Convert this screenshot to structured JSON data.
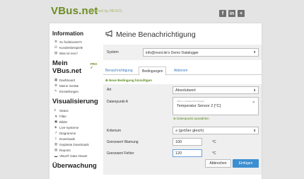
{
  "header": {
    "logo": "VBus.net",
    "logo_sub": "powered by RESOL",
    "social": [
      "f",
      "in",
      "+"
    ]
  },
  "sidebar": {
    "section_information": "Information",
    "information_items": [
      {
        "icon": "gear",
        "label": "So funktioniert's"
      },
      {
        "icon": "sliders",
        "label": "Kundenbeispiele"
      },
      {
        "icon": "doc",
        "label": "Was ist neu?"
      }
    ],
    "section_mein": "Mein VBus.net",
    "pro_badge": "PRO ✔",
    "mein_items": [
      {
        "icon": "dashboard",
        "label": "Dashboard"
      },
      {
        "icon": "gear",
        "label": "Meine Geräte"
      },
      {
        "icon": "wrench",
        "label": "Einstellungen"
      }
    ],
    "section_visual": "Visualisierung",
    "visual_items": [
      {
        "icon": "info",
        "label": "Status"
      },
      {
        "icon": "filter",
        "label": "Filter"
      },
      {
        "icon": "image",
        "label": "Bilder"
      },
      {
        "icon": "system",
        "label": "Live-Systeme"
      },
      {
        "icon": "chart",
        "label": "Diagramme"
      },
      {
        "icon": "download",
        "label": "Downloads"
      },
      {
        "icon": "calendar",
        "label": "Geplante Downloads"
      },
      {
        "icon": "reports",
        "label": "Reports"
      },
      {
        "icon": "viewer",
        "label": "VBus® Data Viewer"
      }
    ],
    "section_monitor": "Überwachung"
  },
  "main": {
    "title": "Meine Benachrichtigung",
    "system_label": "System",
    "system_value": "info@resol.de's Demo Datalogger",
    "tabs": [
      "Benachrichtigung",
      "Bedingungen",
      "Aktionen"
    ],
    "active_tab": 1,
    "add_condition": "Neue Bedingung hinzufügen",
    "form": {
      "art_label": "Art",
      "art_value": "Absolutwert",
      "datenpunkt_label": "Datenpunkt A",
      "sensor_sub": "VBus 1: DeltaSol BX (Regler)",
      "sensor_name": "Temperatur Sensor 2 [°C]",
      "sensor_link": "Datenpunkt auswählen",
      "kriterium_label": "Kriterium",
      "kriterium_value": "≥ (größer gleich)",
      "warnung_label": "Grenzwert Warnung",
      "warnung_value": "100",
      "warnung_unit": "°C",
      "fehler_label": "Grenzwert Fehler",
      "fehler_value": "120",
      "fehler_unit": "°C",
      "cancel": "Abbrechen",
      "add": "Einfügen"
    }
  }
}
